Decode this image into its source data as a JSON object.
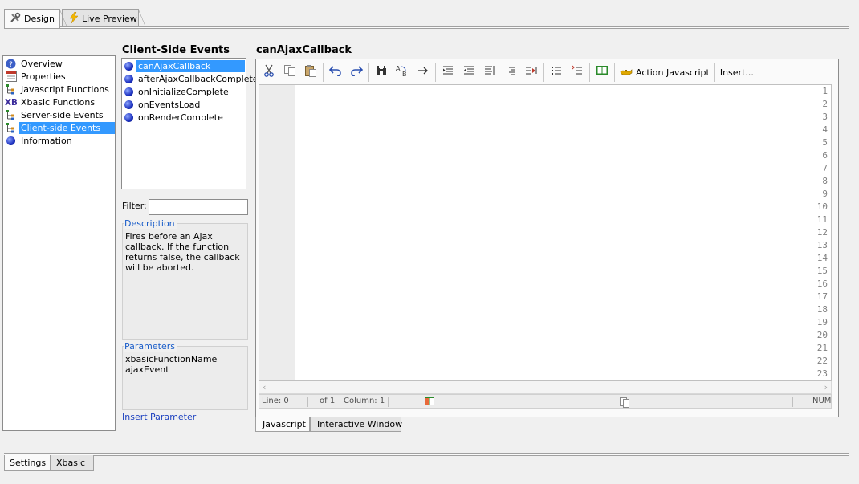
{
  "top_tabs": [
    {
      "label": "Design",
      "icon": "tools-icon",
      "active": true
    },
    {
      "label": "Live Preview",
      "icon": "lightning-icon",
      "active": false
    }
  ],
  "nav": {
    "items": [
      {
        "label": "Overview",
        "icon": "help-icon"
      },
      {
        "label": "Properties",
        "icon": "properties-icon"
      },
      {
        "label": "Javascript Functions",
        "icon": "tree-icon"
      },
      {
        "label": "Xbasic Functions",
        "icon": "xb-icon"
      },
      {
        "label": "Server-side Events",
        "icon": "tree-icon"
      },
      {
        "label": "Client-side Events",
        "icon": "tree-icon",
        "selected": true
      },
      {
        "label": "Information",
        "icon": "globe-icon"
      }
    ]
  },
  "events": {
    "title": "Client-Side Events",
    "items": [
      {
        "label": "canAjaxCallback",
        "selected": true
      },
      {
        "label": "afterAjaxCallbackComplete"
      },
      {
        "label": "onInitializeComplete"
      },
      {
        "label": "onEventsLoad"
      },
      {
        "label": "onRenderComplete"
      }
    ],
    "filter_label": "Filter:",
    "filter_value": "",
    "description_title": "Description",
    "description_text": "Fires before an Ajax callback. If the function returns false, the callback will be aborted.",
    "parameters_title": "Parameters",
    "parameters": [
      "xbasicFunctionName",
      "ajaxEvent"
    ],
    "insert_parameter": "Insert Parameter"
  },
  "editor": {
    "title": "canAjaxCallback",
    "toolbar": {
      "action_javascript": "Action Javascript",
      "insert": "Insert..."
    },
    "line_numbers": [
      "1",
      "2",
      "3",
      "4",
      "5",
      "6",
      "7",
      "8",
      "9",
      "10",
      "11",
      "12",
      "13",
      "14",
      "15",
      "16",
      "17",
      "18",
      "19",
      "20",
      "21",
      "22",
      "23"
    ],
    "status": {
      "line": "Line: 0",
      "of": "of 1",
      "column": "Column: 1",
      "num": "NUM"
    },
    "tabs": [
      {
        "label": "Javascript",
        "active": true
      },
      {
        "label": "Interactive Window",
        "active": false
      }
    ]
  },
  "bottom_tabs": [
    {
      "label": "Settings",
      "active": true
    },
    {
      "label": "Xbasic",
      "active": false
    }
  ],
  "colors": {
    "selection": "#3399ff",
    "link": "#1a3fbf",
    "group_title": "#1a5dc9"
  }
}
